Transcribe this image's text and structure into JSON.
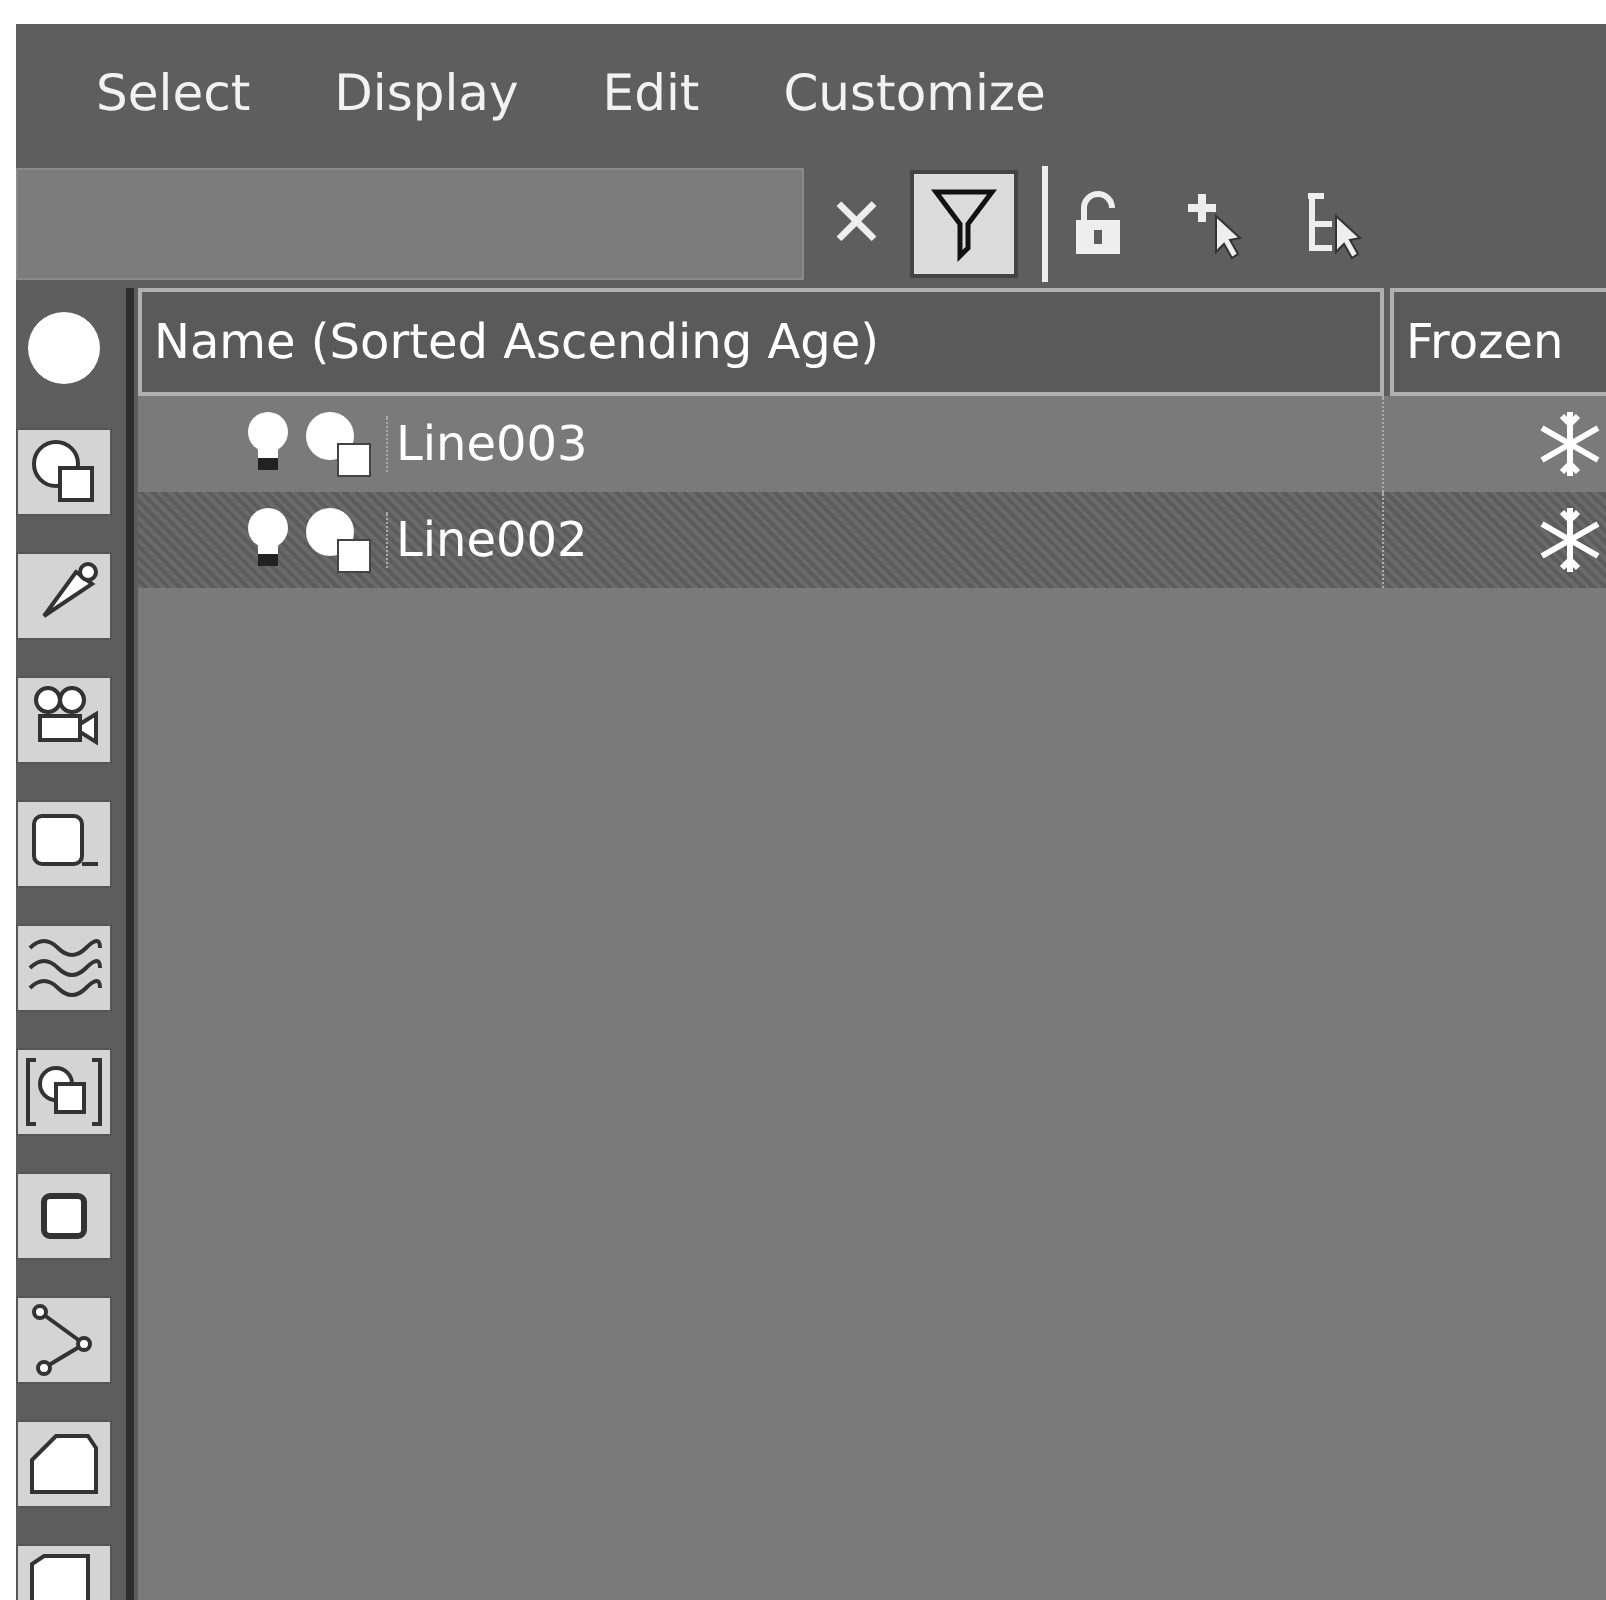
{
  "menu": [
    "Select",
    "Display",
    "Edit",
    "Customize"
  ],
  "toolbar": {
    "clear": "✕",
    "filter_on": true
  },
  "sidebar": [
    {
      "kind": "all"
    },
    {
      "kind": "geometry"
    },
    {
      "kind": "light"
    },
    {
      "kind": "camera"
    },
    {
      "kind": "helper"
    },
    {
      "kind": "spacewarp"
    },
    {
      "kind": "group"
    },
    {
      "kind": "xref"
    },
    {
      "kind": "bone"
    },
    {
      "kind": "container"
    },
    {
      "kind": "more"
    }
  ],
  "table": {
    "columns": [
      "Name (Sorted Ascending Age)",
      "Frozen"
    ],
    "rows": [
      {
        "name": "Line003",
        "selected": false,
        "frozen": true
      },
      {
        "name": "Line002",
        "selected": true,
        "frozen": true
      }
    ]
  }
}
